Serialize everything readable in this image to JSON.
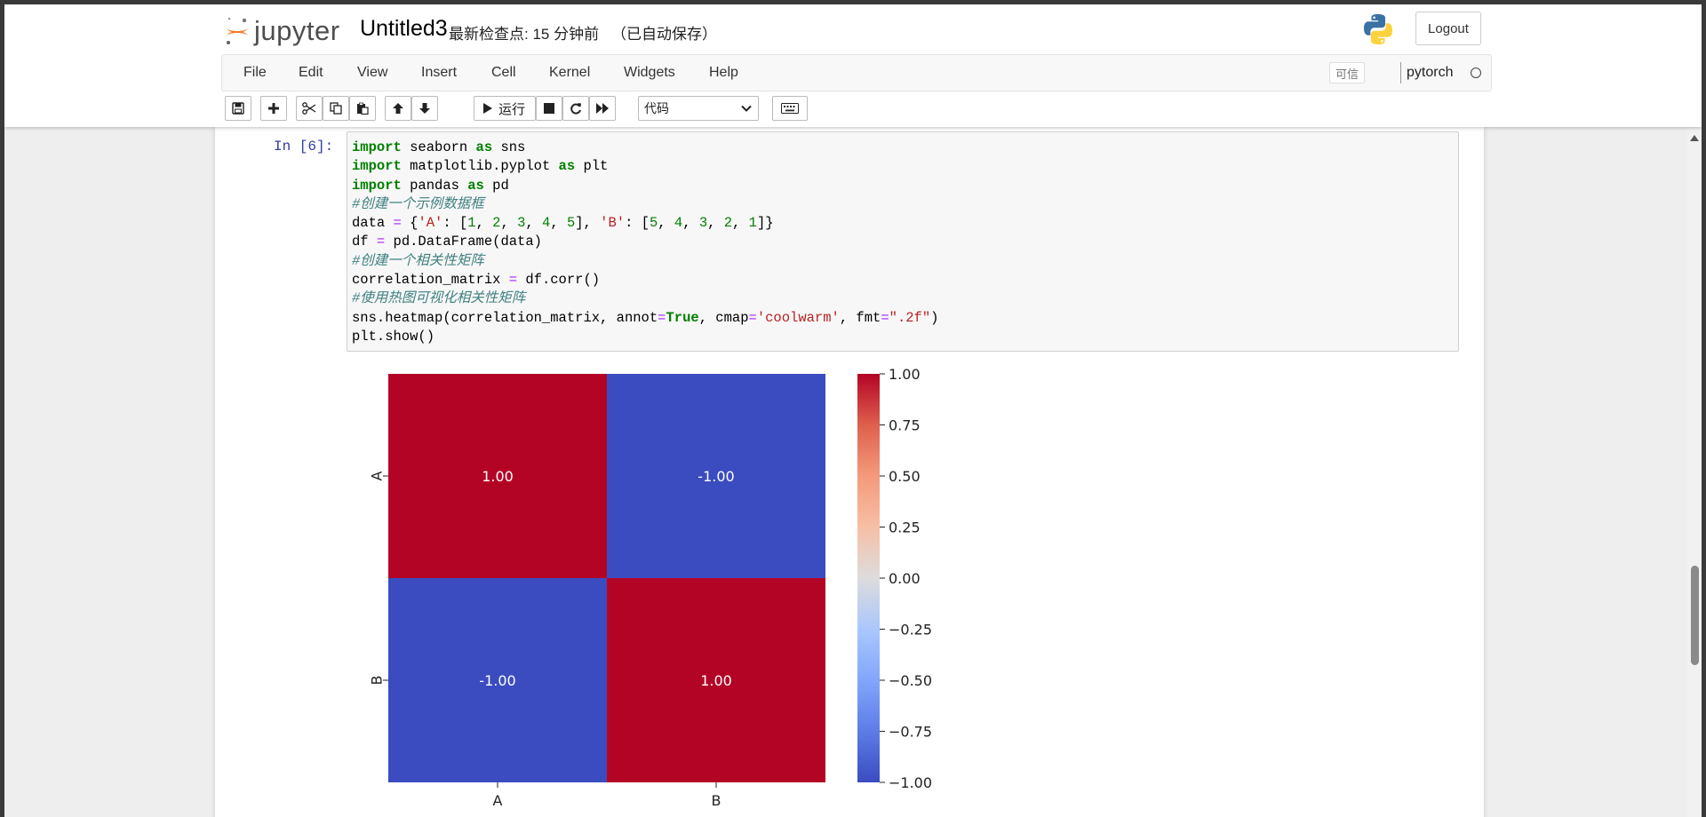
{
  "header": {
    "logo_text": "jupyter",
    "notebook_name": "Untitled3",
    "checkpoint": "最新检查点: 15 分钟前",
    "autosave": "（已自动保存）",
    "logout_label": "Logout"
  },
  "menubar": {
    "items": [
      "File",
      "Edit",
      "View",
      "Insert",
      "Cell",
      "Kernel",
      "Widgets",
      "Help"
    ],
    "trusted_label": "可信",
    "kernel_name": "pytorch"
  },
  "toolbar": {
    "run_label": "运行",
    "cell_type": "代码",
    "icons": [
      "save-icon",
      "plus-icon",
      "scissors-icon",
      "copy-icon",
      "paste-icon",
      "arrow-up-icon",
      "arrow-down-icon",
      "play-icon",
      "stop-icon",
      "restart-icon",
      "fast-forward-icon",
      "keyboard-icon"
    ]
  },
  "cell": {
    "prompt": "In  [6]:",
    "code_lines": [
      "import seaborn as sns",
      "import matplotlib.pyplot as plt",
      "import pandas as pd",
      "#创建一个示例数据框",
      "data = {'A': [1, 2, 3, 4, 5], 'B': [5, 4, 3, 2, 1]}",
      "df = pd.DataFrame(data)",
      "#创建一个相关性矩阵",
      "correlation_matrix = df.corr()",
      "#使用热图可视化相关性矩阵",
      "sns.heatmap(correlation_matrix, annot=True, cmap='coolwarm', fmt=\".2f\")",
      "plt.show()"
    ]
  },
  "colors": {
    "jupyter_orange": "#f37626",
    "heat_high": "#b40426",
    "heat_low": "#3b4cc0",
    "prompt_blue": "#303f9f"
  },
  "chart_data": {
    "type": "heatmap",
    "x_labels": [
      "A",
      "B"
    ],
    "y_labels": [
      "A",
      "B"
    ],
    "values": [
      [
        1.0,
        -1.0
      ],
      [
        -1.0,
        1.0
      ]
    ],
    "annotations": [
      [
        "1.00",
        "-1.00"
      ],
      [
        "-1.00",
        "1.00"
      ]
    ],
    "colormap": "coolwarm",
    "vmin": -1.0,
    "vmax": 1.0,
    "colorbar_ticks": [
      "1.00",
      "0.75",
      "0.50",
      "0.25",
      "0.00",
      "−0.25",
      "−0.50",
      "−0.75",
      "−1.00"
    ],
    "colorbar_tick_values": [
      1.0,
      0.75,
      0.5,
      0.25,
      0.0,
      -0.25,
      -0.5,
      -0.75,
      -1.0
    ],
    "title": "",
    "xlabel": "",
    "ylabel": ""
  }
}
